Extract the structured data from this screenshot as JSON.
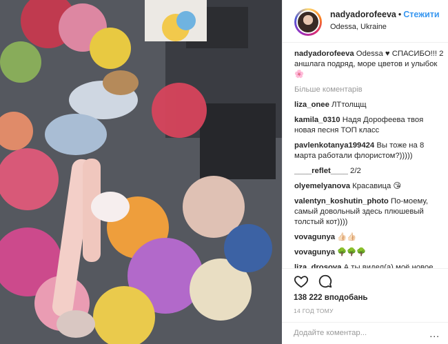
{
  "post_image": {
    "description_icon": "post-photo"
  },
  "header": {
    "username": "nadyadorofeeva",
    "dot": "•",
    "follow_label": "Стежити",
    "location": "Odessa, Ukraine"
  },
  "caption": {
    "user": "nadyadorofeeva",
    "text": "Odessa ♥ СПАСИБО!!! 2 аншлага подряд, море цветов и улыбок 🌸"
  },
  "more_comments_label": "Більше коментарів",
  "comments": [
    {
      "user": "liza_onee",
      "text": "ЛТтолщщ"
    },
    {
      "user": "kamila_0310",
      "text": "Надя Дорофеева твоя новая песня ТОП класс"
    },
    {
      "user": "pavlenkotanya199424",
      "text": "Вы тоже на 8 марта работали флористом?)))))"
    },
    {
      "user": "____reflet____",
      "text": "2/2"
    },
    {
      "user": "olyemelyanova",
      "text": "Красавица 😘"
    },
    {
      "user": "valentyn_koshutin_photo",
      "text": "По-моему, самый довольный здесь плюшевый толстый кот))))"
    },
    {
      "user": "vovagunya",
      "text": "👍🏻👍🏻"
    },
    {
      "user": "vovagunya",
      "text": "🌳🌳🌳"
    },
    {
      "user": "liza_drosova",
      "text": "А ты видел(а) моё новое"
    }
  ],
  "actions": {
    "like_icon": "heart-icon",
    "comment_icon": "comment-icon",
    "likes_text": "138 222 вподобань",
    "time_text": "14 ГОД ТОМУ"
  },
  "add_comment": {
    "placeholder": "Додайте коментар...",
    "more_label": "..."
  }
}
